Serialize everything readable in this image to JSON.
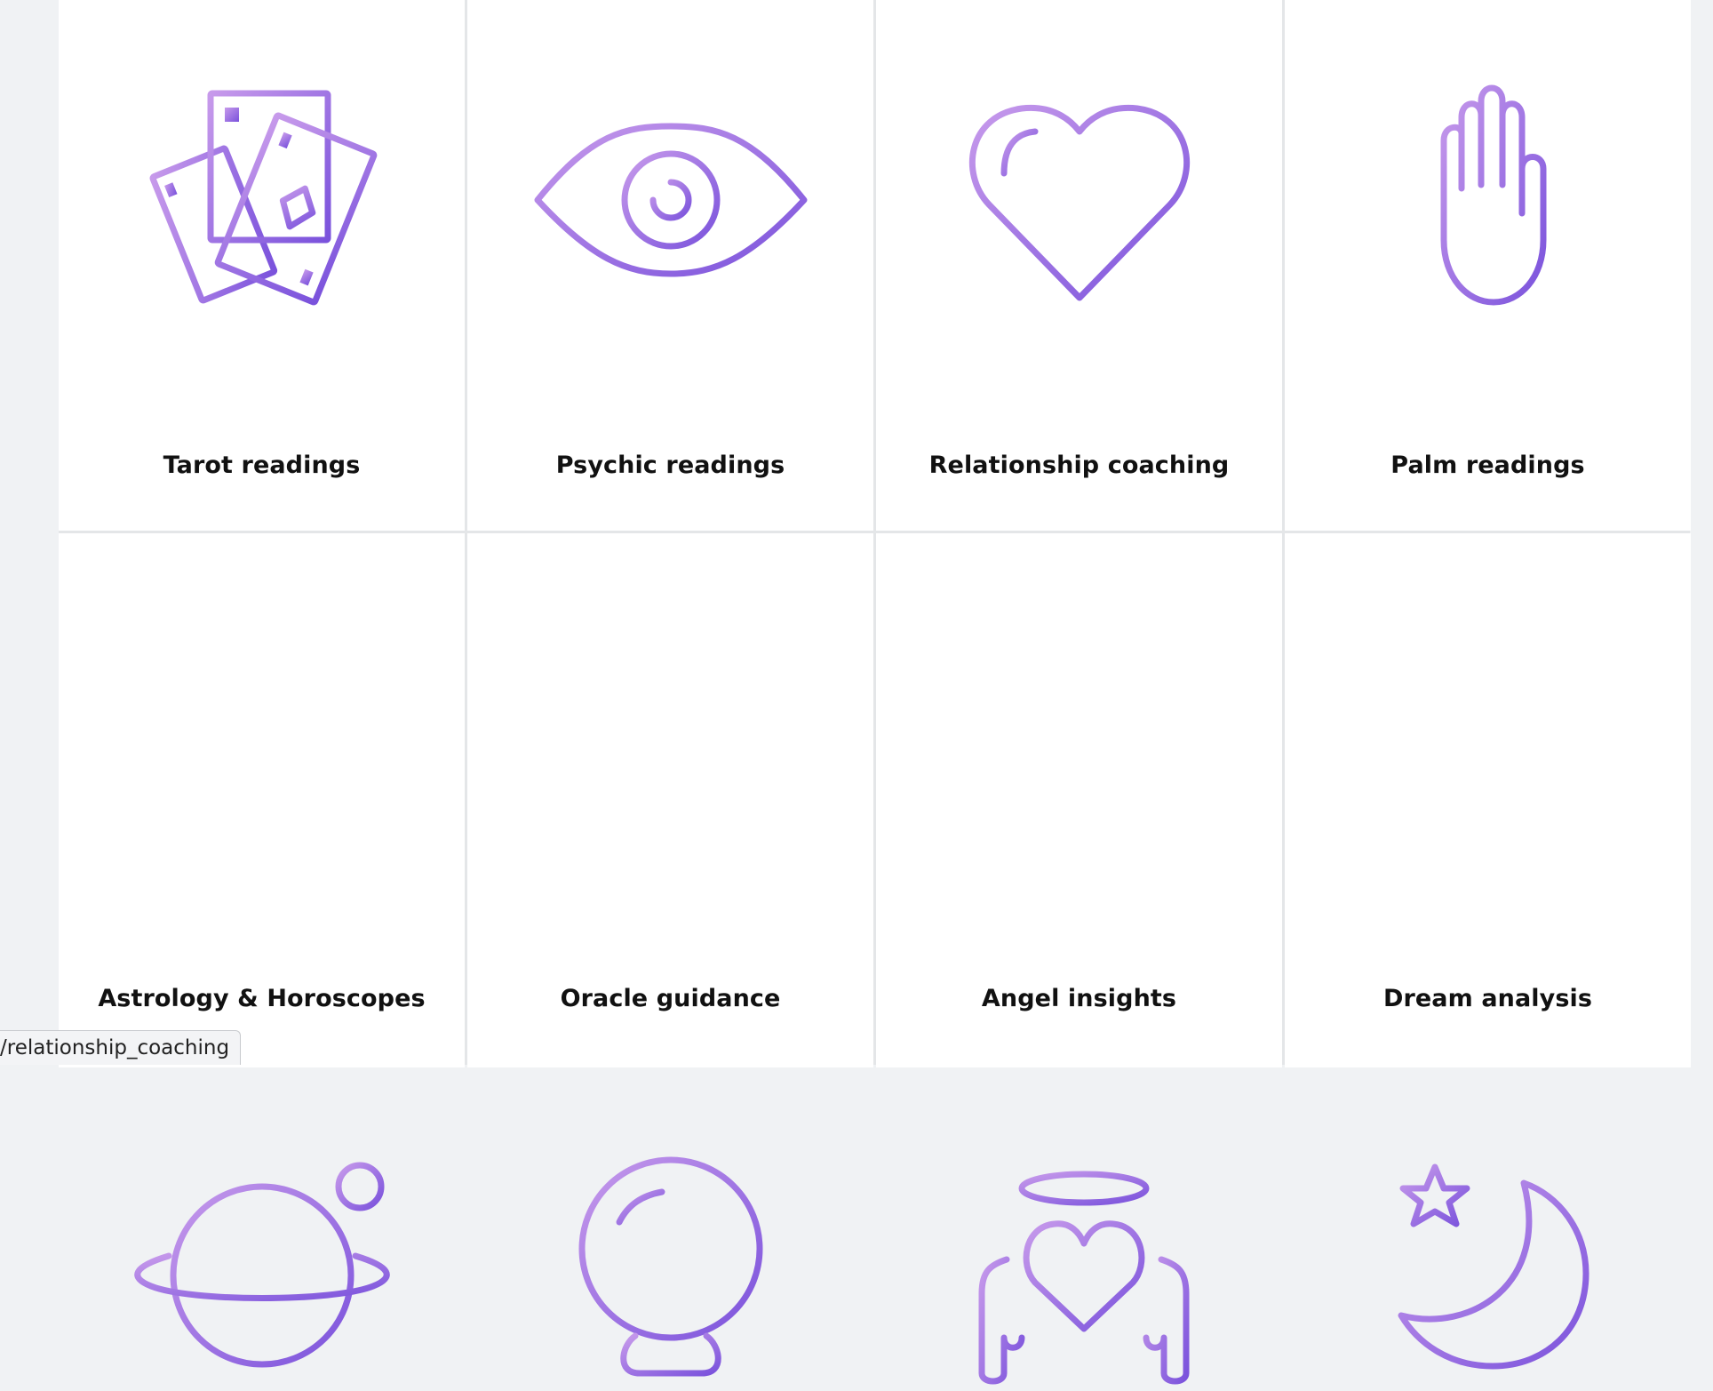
{
  "accent_gradient": {
    "from": "#c79aeb",
    "to": "#7a52dc"
  },
  "services": [
    {
      "label": "Tarot readings",
      "icon": "tarot-cards-icon"
    },
    {
      "label": "Psychic readings",
      "icon": "eye-icon"
    },
    {
      "label": "Relationship coaching",
      "icon": "heart-icon"
    },
    {
      "label": "Palm readings",
      "icon": "palm-hand-icon"
    },
    {
      "label": "Astrology & Horoscopes",
      "icon": "planet-icon"
    },
    {
      "label": "Oracle guidance",
      "icon": "crystal-ball-icon"
    },
    {
      "label": "Angel insights",
      "icon": "angel-heart-icon"
    },
    {
      "label": "Dream analysis",
      "icon": "moon-star-icon"
    }
  ],
  "status_bar": {
    "url": "/relationship_coaching"
  }
}
